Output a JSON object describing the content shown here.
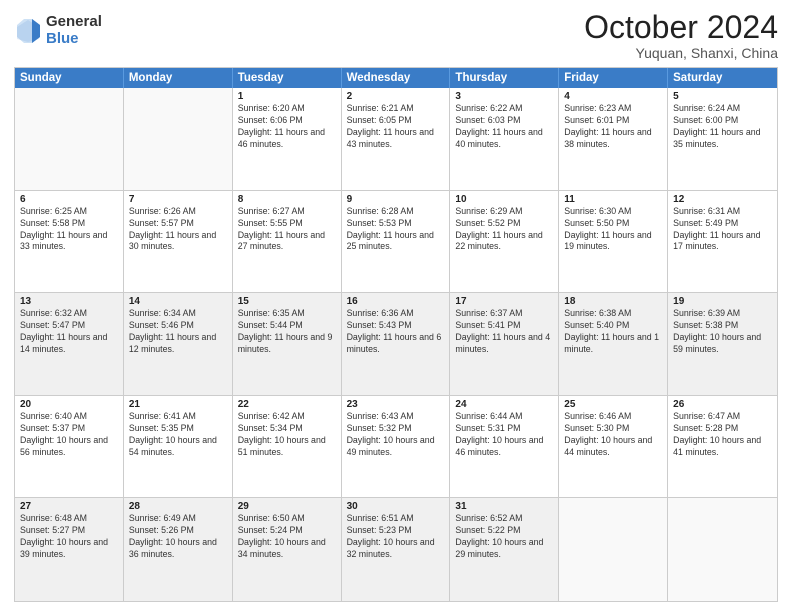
{
  "logo": {
    "general": "General",
    "blue": "Blue"
  },
  "header": {
    "month": "October 2024",
    "location": "Yuquan, Shanxi, China"
  },
  "weekdays": [
    "Sunday",
    "Monday",
    "Tuesday",
    "Wednesday",
    "Thursday",
    "Friday",
    "Saturday"
  ],
  "rows": [
    [
      {
        "day": "",
        "sunrise": "",
        "sunset": "",
        "daylight": "",
        "shaded": true
      },
      {
        "day": "",
        "sunrise": "",
        "sunset": "",
        "daylight": "",
        "shaded": true
      },
      {
        "day": "1",
        "sunrise": "Sunrise: 6:20 AM",
        "sunset": "Sunset: 6:06 PM",
        "daylight": "Daylight: 11 hours and 46 minutes."
      },
      {
        "day": "2",
        "sunrise": "Sunrise: 6:21 AM",
        "sunset": "Sunset: 6:05 PM",
        "daylight": "Daylight: 11 hours and 43 minutes."
      },
      {
        "day": "3",
        "sunrise": "Sunrise: 6:22 AM",
        "sunset": "Sunset: 6:03 PM",
        "daylight": "Daylight: 11 hours and 40 minutes."
      },
      {
        "day": "4",
        "sunrise": "Sunrise: 6:23 AM",
        "sunset": "Sunset: 6:01 PM",
        "daylight": "Daylight: 11 hours and 38 minutes."
      },
      {
        "day": "5",
        "sunrise": "Sunrise: 6:24 AM",
        "sunset": "Sunset: 6:00 PM",
        "daylight": "Daylight: 11 hours and 35 minutes."
      }
    ],
    [
      {
        "day": "6",
        "sunrise": "Sunrise: 6:25 AM",
        "sunset": "Sunset: 5:58 PM",
        "daylight": "Daylight: 11 hours and 33 minutes."
      },
      {
        "day": "7",
        "sunrise": "Sunrise: 6:26 AM",
        "sunset": "Sunset: 5:57 PM",
        "daylight": "Daylight: 11 hours and 30 minutes."
      },
      {
        "day": "8",
        "sunrise": "Sunrise: 6:27 AM",
        "sunset": "Sunset: 5:55 PM",
        "daylight": "Daylight: 11 hours and 27 minutes."
      },
      {
        "day": "9",
        "sunrise": "Sunrise: 6:28 AM",
        "sunset": "Sunset: 5:53 PM",
        "daylight": "Daylight: 11 hours and 25 minutes."
      },
      {
        "day": "10",
        "sunrise": "Sunrise: 6:29 AM",
        "sunset": "Sunset: 5:52 PM",
        "daylight": "Daylight: 11 hours and 22 minutes."
      },
      {
        "day": "11",
        "sunrise": "Sunrise: 6:30 AM",
        "sunset": "Sunset: 5:50 PM",
        "daylight": "Daylight: 11 hours and 19 minutes."
      },
      {
        "day": "12",
        "sunrise": "Sunrise: 6:31 AM",
        "sunset": "Sunset: 5:49 PM",
        "daylight": "Daylight: 11 hours and 17 minutes."
      }
    ],
    [
      {
        "day": "13",
        "sunrise": "Sunrise: 6:32 AM",
        "sunset": "Sunset: 5:47 PM",
        "daylight": "Daylight: 11 hours and 14 minutes.",
        "shaded": true
      },
      {
        "day": "14",
        "sunrise": "Sunrise: 6:34 AM",
        "sunset": "Sunset: 5:46 PM",
        "daylight": "Daylight: 11 hours and 12 minutes.",
        "shaded": true
      },
      {
        "day": "15",
        "sunrise": "Sunrise: 6:35 AM",
        "sunset": "Sunset: 5:44 PM",
        "daylight": "Daylight: 11 hours and 9 minutes.",
        "shaded": true
      },
      {
        "day": "16",
        "sunrise": "Sunrise: 6:36 AM",
        "sunset": "Sunset: 5:43 PM",
        "daylight": "Daylight: 11 hours and 6 minutes.",
        "shaded": true
      },
      {
        "day": "17",
        "sunrise": "Sunrise: 6:37 AM",
        "sunset": "Sunset: 5:41 PM",
        "daylight": "Daylight: 11 hours and 4 minutes.",
        "shaded": true
      },
      {
        "day": "18",
        "sunrise": "Sunrise: 6:38 AM",
        "sunset": "Sunset: 5:40 PM",
        "daylight": "Daylight: 11 hours and 1 minute.",
        "shaded": true
      },
      {
        "day": "19",
        "sunrise": "Sunrise: 6:39 AM",
        "sunset": "Sunset: 5:38 PM",
        "daylight": "Daylight: 10 hours and 59 minutes.",
        "shaded": true
      }
    ],
    [
      {
        "day": "20",
        "sunrise": "Sunrise: 6:40 AM",
        "sunset": "Sunset: 5:37 PM",
        "daylight": "Daylight: 10 hours and 56 minutes."
      },
      {
        "day": "21",
        "sunrise": "Sunrise: 6:41 AM",
        "sunset": "Sunset: 5:35 PM",
        "daylight": "Daylight: 10 hours and 54 minutes."
      },
      {
        "day": "22",
        "sunrise": "Sunrise: 6:42 AM",
        "sunset": "Sunset: 5:34 PM",
        "daylight": "Daylight: 10 hours and 51 minutes."
      },
      {
        "day": "23",
        "sunrise": "Sunrise: 6:43 AM",
        "sunset": "Sunset: 5:32 PM",
        "daylight": "Daylight: 10 hours and 49 minutes."
      },
      {
        "day": "24",
        "sunrise": "Sunrise: 6:44 AM",
        "sunset": "Sunset: 5:31 PM",
        "daylight": "Daylight: 10 hours and 46 minutes."
      },
      {
        "day": "25",
        "sunrise": "Sunrise: 6:46 AM",
        "sunset": "Sunset: 5:30 PM",
        "daylight": "Daylight: 10 hours and 44 minutes."
      },
      {
        "day": "26",
        "sunrise": "Sunrise: 6:47 AM",
        "sunset": "Sunset: 5:28 PM",
        "daylight": "Daylight: 10 hours and 41 minutes."
      }
    ],
    [
      {
        "day": "27",
        "sunrise": "Sunrise: 6:48 AM",
        "sunset": "Sunset: 5:27 PM",
        "daylight": "Daylight: 10 hours and 39 minutes.",
        "shaded": true
      },
      {
        "day": "28",
        "sunrise": "Sunrise: 6:49 AM",
        "sunset": "Sunset: 5:26 PM",
        "daylight": "Daylight: 10 hours and 36 minutes.",
        "shaded": true
      },
      {
        "day": "29",
        "sunrise": "Sunrise: 6:50 AM",
        "sunset": "Sunset: 5:24 PM",
        "daylight": "Daylight: 10 hours and 34 minutes.",
        "shaded": true
      },
      {
        "day": "30",
        "sunrise": "Sunrise: 6:51 AM",
        "sunset": "Sunset: 5:23 PM",
        "daylight": "Daylight: 10 hours and 32 minutes.",
        "shaded": true
      },
      {
        "day": "31",
        "sunrise": "Sunrise: 6:52 AM",
        "sunset": "Sunset: 5:22 PM",
        "daylight": "Daylight: 10 hours and 29 minutes.",
        "shaded": true
      },
      {
        "day": "",
        "sunrise": "",
        "sunset": "",
        "daylight": "",
        "shaded": true
      },
      {
        "day": "",
        "sunrise": "",
        "sunset": "",
        "daylight": "",
        "shaded": true
      }
    ]
  ]
}
